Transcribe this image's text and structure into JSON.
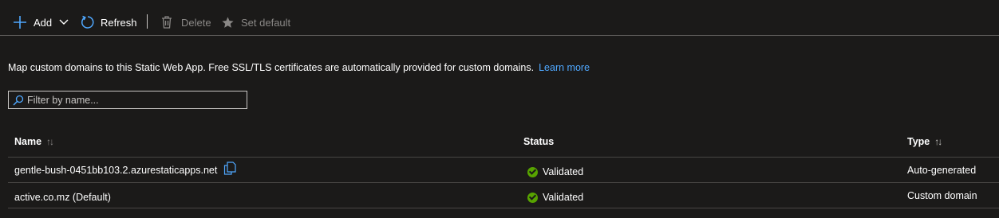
{
  "toolbar": {
    "add_label": "Add",
    "refresh_label": "Refresh",
    "delete_label": "Delete",
    "set_default_label": "Set default"
  },
  "description": {
    "text": "Map custom domains to this Static Web App. Free SSL/TLS certificates are automatically provided for custom domains.",
    "learn_more": "Learn more"
  },
  "filter": {
    "placeholder": "Filter by name...",
    "value": ""
  },
  "table": {
    "headers": {
      "name": "Name",
      "status": "Status",
      "type": "Type"
    },
    "rows": [
      {
        "name": "gentle-bush-0451bb103.2.azurestaticapps.net",
        "status": "Validated",
        "type": "Auto-generated"
      },
      {
        "name": "active.co.mz (Default)",
        "status": "Validated",
        "type": "Custom domain"
      }
    ]
  },
  "colors": {
    "accent": "#4fa8ff",
    "success": "#57a300",
    "background": "#1b1a19"
  }
}
